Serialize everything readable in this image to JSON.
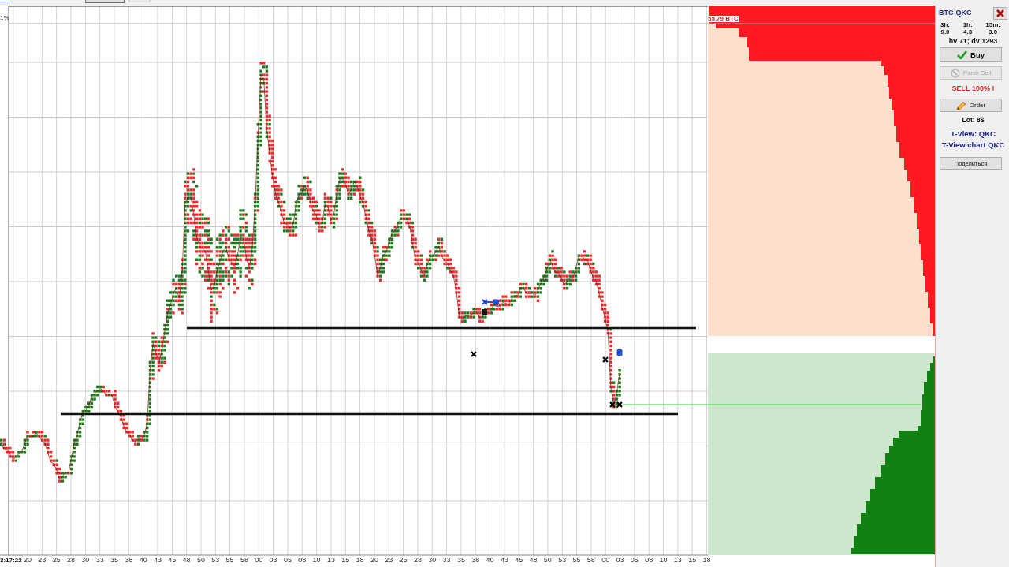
{
  "chart": {
    "y_axis_label": "1%",
    "time_axis": {
      "start_label": "3:17:22",
      "labels": [
        "20",
        "23",
        "25",
        "28",
        "30",
        "33",
        "35",
        "38",
        "40",
        "43",
        "45",
        "48",
        "50",
        "53",
        "55",
        "58",
        "00",
        "03",
        "05",
        "08",
        "10",
        "13",
        "15",
        "18",
        "20",
        "23",
        "25",
        "28",
        "30",
        "33",
        "35",
        "38",
        "40",
        "43",
        "45",
        "48",
        "50",
        "53",
        "55",
        "58",
        "00",
        "03",
        "05",
        "08",
        "10",
        "13",
        "15",
        "18"
      ]
    }
  },
  "order_book": {
    "volume_label": "55.79 BTC"
  },
  "side_panel": {
    "title": "BTC-QKC",
    "intervals": [
      {
        "label": "3h:",
        "value": "9.0"
      },
      {
        "label": "1h:",
        "value": "4.3"
      },
      {
        "label": "15m:",
        "value": "3.0"
      }
    ],
    "volume_info": "hv 71; dv 1293",
    "trade_buttons": [
      {
        "kind": "buy",
        "label": "Buy",
        "disabled": false
      },
      {
        "kind": "panic",
        "label": "Panic Sell",
        "disabled": true
      }
    ],
    "sell_notice": "SELL 100% !",
    "order_button": {
      "label": "Order"
    },
    "lot": "Lot: 8$",
    "links": [
      "T-View: QKC",
      "T-View chart QKC"
    ],
    "share_button": {
      "label": "Поделиться"
    }
  }
}
